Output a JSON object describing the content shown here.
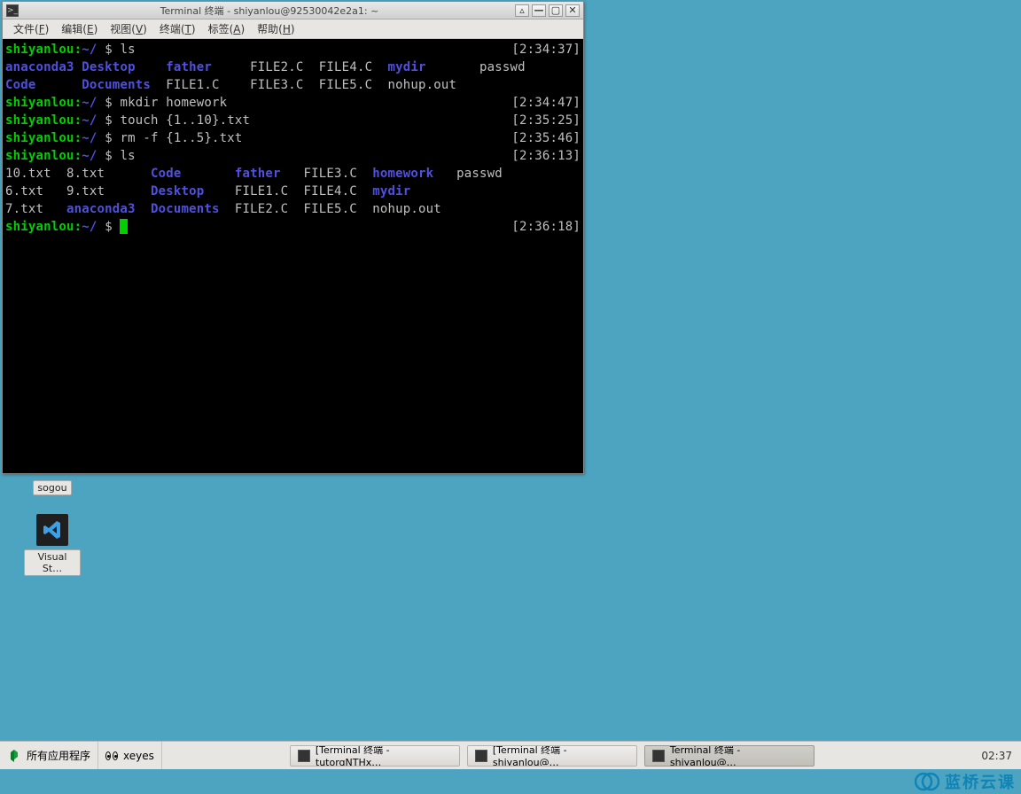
{
  "window": {
    "title": "Terminal 终端 - shiyanlou@92530042e2a1: ~"
  },
  "menu": {
    "file": "文件(",
    "file_key": "F",
    "file_end": ")",
    "edit": "编辑(",
    "edit_key": "E",
    "edit_end": ")",
    "view": "视图(",
    "view_key": "V",
    "view_end": ")",
    "term": "终端(",
    "term_key": "T",
    "term_end": ")",
    "tabs": "标签(",
    "tabs_key": "A",
    "tabs_end": ")",
    "help": "帮助(",
    "help_key": "H",
    "help_end": ")"
  },
  "prompt": {
    "user": "shiyanlou:",
    "path": "~/",
    "sep": " $ "
  },
  "history": [
    {
      "cmd": "ls",
      "ts": "[2:34:37]"
    },
    {
      "cmd": "mkdir homework",
      "ts": "[2:34:47]"
    },
    {
      "cmd": "touch {1..10}.txt",
      "ts": "[2:35:25]"
    },
    {
      "cmd": "rm -f {1..5}.txt",
      "ts": "[2:35:46]"
    },
    {
      "cmd": "ls",
      "ts": "[2:36:13]"
    }
  ],
  "ls1": {
    "r1": {
      "c1": "anaconda3",
      "c2": "Desktop",
      "c3": "father",
      "c4": "FILE2.C",
      "c5": "FILE4.C",
      "c6": "mydir",
      "c7": "passwd"
    },
    "r2": {
      "c1": "Code",
      "c2": "Documents",
      "c3": "FILE1.C",
      "c4": "FILE3.C",
      "c5": "FILE5.C",
      "c6": "nohup.out",
      "c7": ""
    }
  },
  "ls2": {
    "r1": {
      "c1": "10.txt",
      "c2": "8.txt",
      "c3": "Code",
      "c4": "father",
      "c5": "FILE3.C",
      "c6": "homework",
      "c7": "passwd"
    },
    "r2": {
      "c1": "6.txt",
      "c2": "9.txt",
      "c3": "Desktop",
      "c4": "FILE1.C",
      "c5": "FILE4.C",
      "c6": "mydir",
      "c7": ""
    },
    "r3": {
      "c1": "7.txt",
      "c2": "anaconda3",
      "c3": "Documents",
      "c4": "FILE2.C",
      "c5": "FILE5.C",
      "c6": "nohup.out",
      "c7": ""
    }
  },
  "current_ts": "[2:36:18]",
  "desktop": {
    "sogou": "sogou",
    "vscode": "Visual St…"
  },
  "taskbar": {
    "apps_label": "所有应用程序",
    "xeyes": "xeyes",
    "task1": "[Terminal 终端 - tutorgNTHx…",
    "task2": "[Terminal 终端 - shiyanlou@…",
    "task3": "Terminal 终端 - shiyanlou@…",
    "clock": "02:37"
  },
  "watermark": "蓝桥云课",
  "colors": {
    "dir": "#5050e0",
    "exec": "#00d000",
    "ts": "#c0c0c0"
  }
}
